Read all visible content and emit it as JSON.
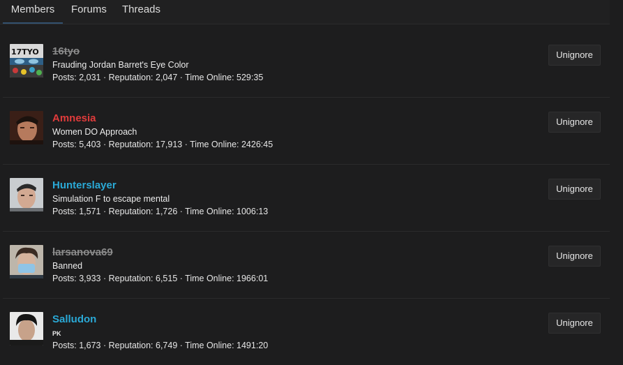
{
  "tabs": [
    {
      "label": "Members",
      "active": true
    },
    {
      "label": "Forums",
      "active": false
    },
    {
      "label": "Threads",
      "active": false
    }
  ],
  "colors": {
    "banned": "#8b8b8b",
    "red_group": "#e03b3b",
    "blue_group": "#2aa9d6",
    "tab_underline": "#33516f"
  },
  "members": [
    {
      "name": "16tyo",
      "avatar_text": "17TYO",
      "title": "Frauding Jordan Barret's Eye Color",
      "stats": "Posts: 2,031 · Reputation: 2,047 · Time Online: 529:35",
      "action": "Unignore",
      "style": "banned"
    },
    {
      "name": "Amnesia",
      "title": "Women DO Approach",
      "stats": "Posts: 5,403 · Reputation: 17,913 · Time Online: 2426:45",
      "action": "Unignore",
      "style": "red"
    },
    {
      "name": "Hunterslayer",
      "title": "Simulation F to escape mental",
      "stats": "Posts: 1,571 · Reputation: 1,726 · Time Online: 1006:13",
      "action": "Unignore",
      "style": "blue"
    },
    {
      "name": "larsanova69",
      "title": "Banned",
      "stats": "Posts: 3,933 · Reputation: 6,515 · Time Online: 1966:01",
      "action": "Unignore",
      "style": "banned"
    },
    {
      "name": "Salludon",
      "title": "PK",
      "stats": "Posts: 1,673 · Reputation: 6,749 · Time Online: 1491:20",
      "action": "Unignore",
      "style": "blue"
    }
  ]
}
